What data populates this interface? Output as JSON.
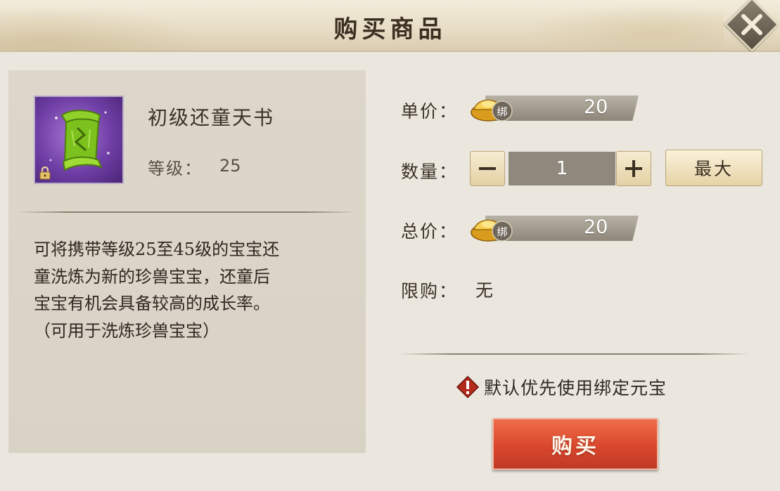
{
  "dialog": {
    "title": "购买商品"
  },
  "item": {
    "name": "初级还童天书",
    "level_label": "等级：",
    "level_value": "25",
    "description": [
      "可将携带等级25至45级的宝宝还",
      "童洗炼为新的珍兽宝宝，还童后",
      "宝宝有机会具备较高的成长率。",
      "（可用于洗炼珍兽宝宝）"
    ],
    "icon": "green-scroll-icon",
    "bound_icon": "lock-icon"
  },
  "purchase": {
    "unit_price_label": "单价：",
    "unit_price": "20",
    "quantity_label": "数量：",
    "quantity": "1",
    "max_label": "最大",
    "total_price_label": "总价：",
    "total_price": "20",
    "limit_label": "限购：",
    "limit_value": "无",
    "currency_tag": "绑",
    "currency_icon": "gold-ingot-icon",
    "notice": "默认优先使用绑定元宝",
    "buy_label": "购买"
  },
  "colors": {
    "buy_button": "#d9472c",
    "panel": "#ddd7cb",
    "header": "#e7dcc4"
  }
}
